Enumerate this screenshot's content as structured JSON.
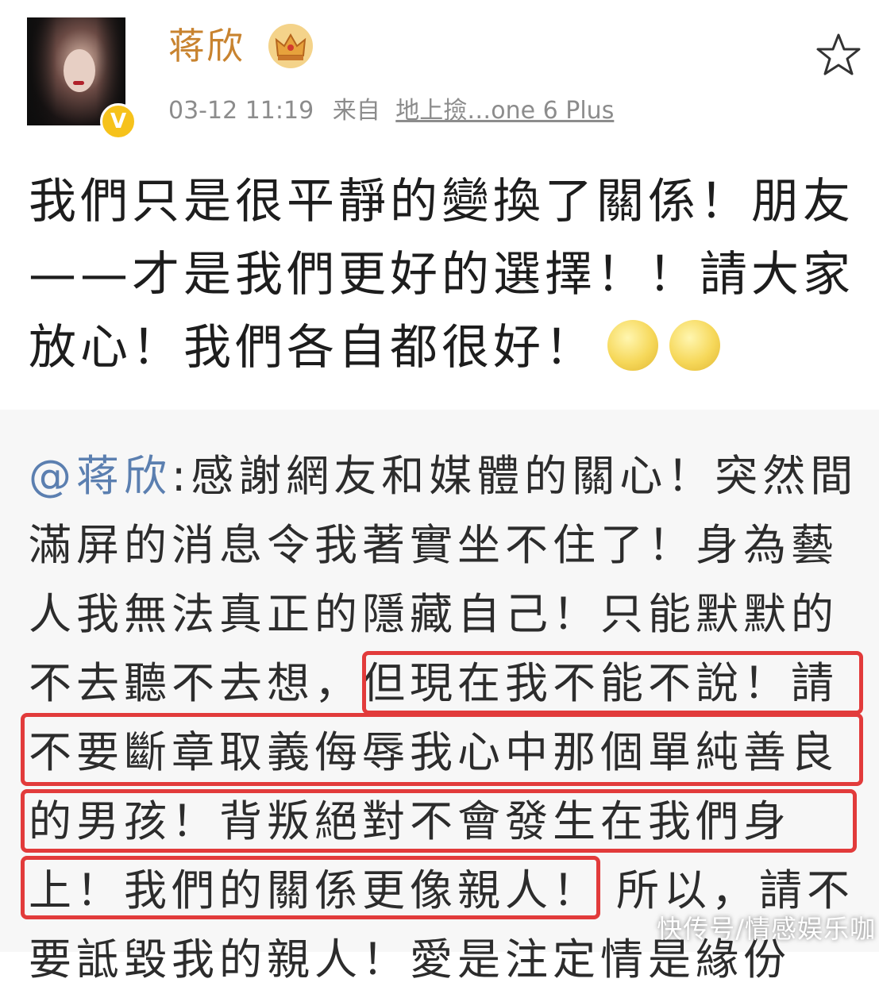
{
  "profile": {
    "username": "蒋欣",
    "timestamp": "03-12 11:19",
    "source_prefix": "来自",
    "source": "地上撿…one 6 Plus"
  },
  "icons": {
    "avatar": "avatar-photo",
    "verified": "verified-v-icon",
    "crown": "crown-badge-icon",
    "favorite": "star-outline-icon",
    "emoji": "smile-emoji-icon"
  },
  "post": {
    "lines": [
      "我們只是很平靜的變換了關係！朋友",
      "——才是我們更好的選擇！！請大家",
      "放心！我們各自都很好！"
    ]
  },
  "quote": {
    "mention": "@蒋欣",
    "line1_rest": ":感謝網友和媒體的關心！突然間",
    "line2": "滿屏的消息令我著實坐不住了！身為藝",
    "line3": "人我無法真正的隱藏自己！只能默默的",
    "line4_a": "不去聽不去想，",
    "line4_b": "但現在我不能不說！請",
    "line5": "不要斷章取義侮辱我心中那個單純善良",
    "line6": "的男孩！背叛絕對不會發生在我們身",
    "line7_a": "上！我們的關係更像親人！",
    "line7_b": "所以，請不",
    "line8": "要詆毀我的親人！愛是注定情是緣份"
  },
  "watermark": "快传号/情感娱乐咖",
  "colors": {
    "highlight_box": "#e23b3b",
    "mention": "#5b7fb0",
    "username": "#c8832f"
  }
}
